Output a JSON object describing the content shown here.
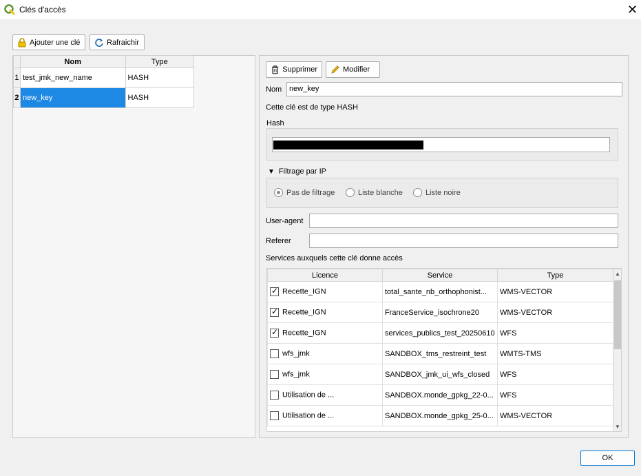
{
  "window": {
    "title": "Clés d'accès",
    "close_glyph": "✕"
  },
  "toolbar": {
    "add_label": "Ajouter une clé",
    "refresh_label": "Rafraichir"
  },
  "keys_table": {
    "headers": [
      "Nom",
      "Type"
    ],
    "rows": [
      {
        "num": "1",
        "name": "test_jmk_new_name",
        "type": "HASH"
      },
      {
        "num": "2",
        "name": "new_key",
        "type": "HASH"
      }
    ]
  },
  "detail": {
    "delete_label": "Supprimer",
    "modify_label": "Modifier",
    "name_label": "Nom",
    "name_value": "new_key",
    "type_text": "Cette clé est de type HASH",
    "hash_label": "Hash",
    "ip_filter_label": "Filtrage par IP",
    "ip_options": [
      "Pas de filtrage",
      "Liste blanche",
      "Liste noire"
    ],
    "user_agent_label": "User-agent",
    "referer_label": "Referer",
    "services_label": "Services auxquels cette clé donne accès"
  },
  "services_table": {
    "headers": [
      "Licence",
      "Service",
      "Type"
    ],
    "rows": [
      {
        "checked": true,
        "licence": "Recette_IGN",
        "service": "total_sante_nb_orthophonist...",
        "type": "WMS-VECTOR"
      },
      {
        "checked": true,
        "licence": "Recette_IGN",
        "service": "FranceService_isochrone20",
        "type": "WMS-VECTOR"
      },
      {
        "checked": true,
        "licence": "Recette_IGN",
        "service": "services_publics_test_20250610",
        "type": "WFS"
      },
      {
        "checked": false,
        "licence": "wfs_jmk",
        "service": "SANDBOX_tms_restreint_test",
        "type": "WMTS-TMS"
      },
      {
        "checked": false,
        "licence": "wfs_jmk",
        "service": "SANDBOX_jmk_ui_wfs_closed",
        "type": "WFS"
      },
      {
        "checked": false,
        "licence": "Utilisation de ...",
        "service": "SANDBOX.monde_gpkg_22-0...",
        "type": "WFS"
      },
      {
        "checked": false,
        "licence": "Utilisation de ...",
        "service": "SANDBOX.monde_gpkg_25-0...",
        "type": "WMS-VECTOR"
      }
    ]
  },
  "footer": {
    "ok_label": "OK"
  },
  "colors": {
    "selection": "#1e88e5",
    "qgis_green": "#589632"
  }
}
